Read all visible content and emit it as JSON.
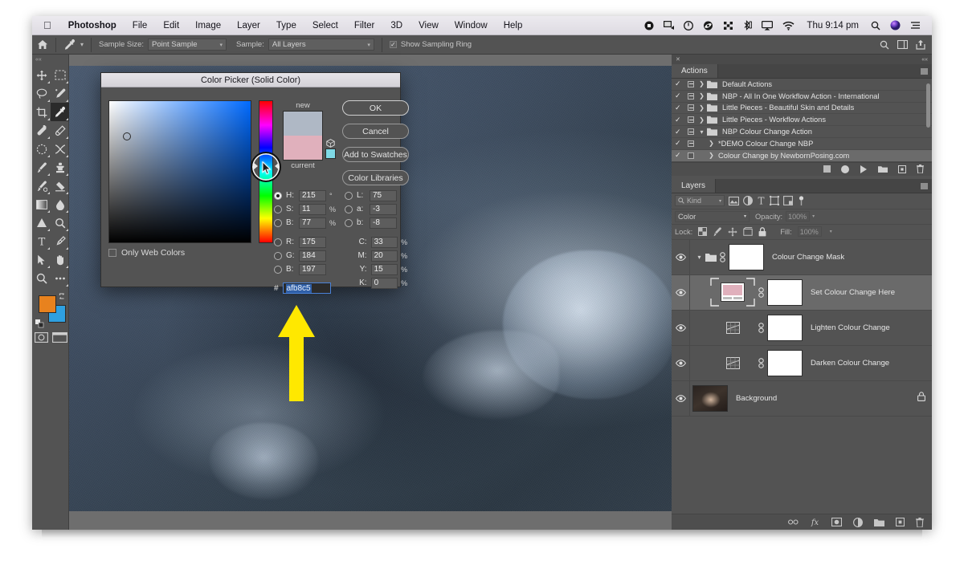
{
  "menubar": {
    "apple": "apple-logo",
    "items": [
      "Photoshop",
      "File",
      "Edit",
      "Image",
      "Layer",
      "Type",
      "Select",
      "Filter",
      "3D",
      "View",
      "Window",
      "Help"
    ],
    "status_icons": [
      "record-icon",
      "screen-share-icon",
      "do-not-disturb-icon",
      "dropbox-icon",
      "shuffle-icon",
      "bluetooth-icon",
      "airplay-icon",
      "wifi-icon"
    ],
    "clock": "Thu 9:14 pm",
    "right_icons": [
      "search-icon",
      "siri-icon",
      "notification-center-icon"
    ]
  },
  "options_bar": {
    "home_icon": "home-icon",
    "tool_icon": "eyedropper-icon",
    "sample_size_label": "Sample Size:",
    "sample_size_value": "Point Sample",
    "sample_label": "Sample:",
    "sample_value": "All Layers",
    "show_sampling_ring_label": "Show Sampling Ring",
    "show_sampling_ring_checked": true,
    "right_icons": [
      "search-icon",
      "workspace-icon",
      "share-icon"
    ]
  },
  "tools": [
    {
      "name": "move-tool",
      "glyph": "✥"
    },
    {
      "name": "rectangular-marquee-tool",
      "glyph": "▢"
    },
    {
      "name": "lasso-tool",
      "glyph": "◯"
    },
    {
      "name": "quick-selection-tool",
      "glyph": "✎"
    },
    {
      "name": "crop-tool",
      "glyph": "⌗"
    },
    {
      "name": "eyedropper-tool",
      "glyph": "⚲"
    },
    {
      "name": "spot-healing-brush-tool",
      "glyph": "✚"
    },
    {
      "name": "patch-tool",
      "glyph": "▱"
    },
    {
      "name": "frame-tool",
      "glyph": "◌"
    },
    {
      "name": "shuffle-tool",
      "glyph": "✕"
    },
    {
      "name": "brush-tool",
      "glyph": "✐"
    },
    {
      "name": "clone-stamp-tool",
      "glyph": "♜"
    },
    {
      "name": "history-brush-tool",
      "glyph": "✒"
    },
    {
      "name": "eraser-tool",
      "glyph": "◣"
    },
    {
      "name": "gradient-tool",
      "glyph": "▤"
    },
    {
      "name": "blur-tool",
      "glyph": "◐"
    },
    {
      "name": "dodge-tool",
      "glyph": "▲"
    },
    {
      "name": "burn-tool",
      "glyph": "⚭"
    },
    {
      "name": "type-tool",
      "glyph": "T"
    },
    {
      "name": "pen-tool",
      "glyph": "✑"
    },
    {
      "name": "path-selection-tool",
      "glyph": "➤"
    },
    {
      "name": "hand-tool",
      "glyph": "✋"
    },
    {
      "name": "zoom-tool",
      "glyph": "⚲"
    },
    {
      "name": "edit-toolbar-tool",
      "glyph": "•••"
    }
  ],
  "tool_swatches": {
    "foreground": "#e8821e",
    "background": "#2fa0e0",
    "active_tool": "eyedropper-tool"
  },
  "color_picker": {
    "title": "Color Picker (Solid Color)",
    "buttons": {
      "ok": "OK",
      "cancel": "Cancel",
      "add_to_swatches": "Add to Swatches",
      "color_libraries": "Color Libraries"
    },
    "new_label": "new",
    "current_label": "current",
    "new_color": "#afb8c5",
    "current_color": "#e0b0bc",
    "web_safe_color": "#7fd9e6",
    "only_web_colors_label": "Only Web Colors",
    "only_web_colors_checked": false,
    "hsb": [
      {
        "name": "H",
        "label": "H:",
        "value": "215",
        "unit": "°",
        "selected": true
      },
      {
        "name": "S",
        "label": "S:",
        "value": "11",
        "unit": "%",
        "selected": false
      },
      {
        "name": "B",
        "label": "B:",
        "value": "77",
        "unit": "%",
        "selected": false
      }
    ],
    "lab": [
      {
        "name": "L",
        "label": "L:",
        "value": "75",
        "unit": "",
        "selected": false
      },
      {
        "name": "a",
        "label": "a:",
        "value": "-3",
        "unit": "",
        "selected": false
      },
      {
        "name": "b",
        "label": "b:",
        "value": "-8",
        "unit": "",
        "selected": false
      }
    ],
    "rgb": [
      {
        "name": "R",
        "label": "R:",
        "value": "175",
        "unit": "",
        "selected": false
      },
      {
        "name": "G",
        "label": "G:",
        "value": "184",
        "unit": "",
        "selected": false
      },
      {
        "name": "B",
        "label": "B:",
        "value": "197",
        "unit": "",
        "selected": false
      }
    ],
    "cmyk": [
      {
        "name": "C",
        "label": "C:",
        "value": "33",
        "unit": "%"
      },
      {
        "name": "M",
        "label": "M:",
        "value": "20",
        "unit": "%"
      },
      {
        "name": "Y",
        "label": "Y:",
        "value": "15",
        "unit": "%"
      },
      {
        "name": "K",
        "label": "K:",
        "value": "0",
        "unit": "%"
      }
    ],
    "hex_symbol": "#",
    "hex_value": "afb8c5"
  },
  "annotation": {
    "arrow_color": "#ffe800"
  },
  "actions_panel": {
    "tab_label": "Actions",
    "rows": [
      {
        "label": "Default Actions",
        "checked": true,
        "has_box": true,
        "expanded": false,
        "is_folder": true,
        "selected": false
      },
      {
        "label": "NBP - All In One Workflow Action - International",
        "checked": true,
        "has_box": true,
        "expanded": false,
        "is_folder": true,
        "selected": false
      },
      {
        "label": "Little Pieces - Beautiful Skin and Details",
        "checked": true,
        "has_box": true,
        "expanded": false,
        "is_folder": true,
        "selected": false
      },
      {
        "label": "Little Pieces - Workflow Actions",
        "checked": true,
        "has_box": true,
        "expanded": false,
        "is_folder": true,
        "selected": false
      },
      {
        "label": "NBP Colour Change Action",
        "checked": true,
        "has_box": true,
        "expanded": true,
        "is_folder": true,
        "selected": false
      },
      {
        "label": "*DEMO Colour Change NBP",
        "checked": true,
        "has_box": true,
        "expanded": false,
        "is_folder": false,
        "indent": true,
        "selected": false
      },
      {
        "label": "Colour Change by NewbornPosing.com",
        "checked": true,
        "has_box": false,
        "expanded": false,
        "is_folder": false,
        "indent": true,
        "selected": true
      }
    ],
    "footer_icons": [
      "stop-icon",
      "record-icon",
      "play-icon",
      "new-set-icon",
      "new-action-icon",
      "delete-icon"
    ]
  },
  "layers_panel": {
    "tab_label": "Layers",
    "filter": {
      "search_icon": "search-icon",
      "kind_label": "Kind",
      "filter_icons": [
        "pixel-layer-filter-icon",
        "adjustment-layer-filter-icon",
        "type-layer-filter-icon",
        "shape-layer-filter-icon",
        "smart-object-filter-icon"
      ],
      "toggle_icon": "filter-toggle-icon"
    },
    "blend_mode": "Color",
    "opacity_label": "Opacity:",
    "opacity_value": "100%",
    "lock_label": "Lock:",
    "lock_icons": [
      "lock-transparent-pixels-icon",
      "lock-image-pixels-icon",
      "lock-position-icon",
      "lock-artboard-icon",
      "lock-all-icon"
    ],
    "fill_label": "Fill:",
    "fill_value": "100%",
    "rows": [
      {
        "name": "Colour Change Mask",
        "type": "group",
        "visible": true,
        "expanded": true,
        "linked": true,
        "thumb": "white-mask",
        "selected": false,
        "locked": false
      },
      {
        "name": "Set Colour Change Here",
        "type": "solid-color",
        "visible": true,
        "linked": true,
        "thumb": "pink-solid",
        "selected": true,
        "locked": false
      },
      {
        "name": "Lighten Colour Change",
        "type": "adjustment",
        "visible": true,
        "linked": true,
        "thumb": "white-mask",
        "selected": false,
        "locked": false
      },
      {
        "name": "Darken Colour Change",
        "type": "adjustment",
        "visible": true,
        "linked": true,
        "thumb": "white-mask",
        "selected": false,
        "locked": false
      },
      {
        "name": "Background",
        "type": "image",
        "visible": true,
        "linked": false,
        "thumb": "photo",
        "selected": false,
        "locked": true
      }
    ],
    "footer_icons": [
      "link-layers-icon",
      "layer-style-icon",
      "add-layer-mask-icon",
      "new-adjustment-layer-icon",
      "new-group-icon",
      "new-layer-icon",
      "delete-layer-icon"
    ]
  }
}
